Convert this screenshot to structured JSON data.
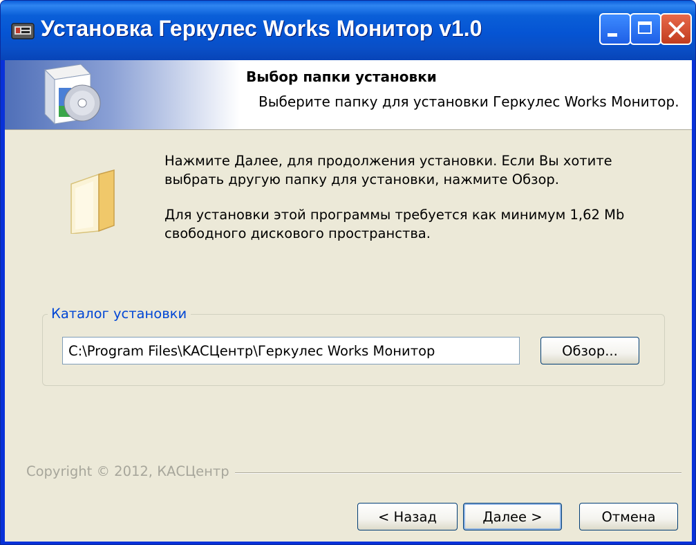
{
  "window": {
    "title": "Установка Геркулес Works Монитор v1.0"
  },
  "header": {
    "title": "Выбор папки установки",
    "subtitle": "Выберите папку для установки Геркулес Works Монитор."
  },
  "body": {
    "line1": "Нажмите Далее, для продолжения установки. Если Вы хотите",
    "line2": "выбрать другую папку для установки, нажмите Обзор.",
    "line3": "Для установки этой программы требуется как минимум 1,62 Mb",
    "line4": "свободного дискового пространства."
  },
  "install_dir": {
    "group_label": "Каталог установки",
    "value": "C:\\Program Files\\KACЦентр\\Геркулес Works Монитор",
    "browse_label": "Обзор..."
  },
  "footer": {
    "copyright": "Copyright © 2012, КАСЦентр",
    "back_label": "< Назад",
    "next_label": "Далее >",
    "cancel_label": "Отмена"
  },
  "colors": {
    "titlebar": "#0554d3",
    "dialog_bg": "#ece9d8",
    "group_label": "#0046d5"
  }
}
